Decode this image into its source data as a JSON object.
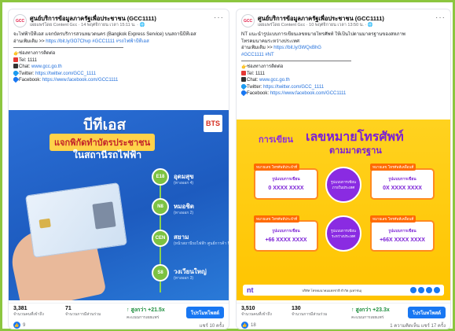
{
  "posts": [
    {
      "page_name": "ศูนย์บริการข้อมูลภาครัฐเพื่อประชาชน (GCC1111)",
      "meta": "เผยแพร่โดย Content Gcc · 14 พฤศจิกายน เวลา 15:11 น. · 🌐",
      "body_line1": "จะไฟฟ้าบีทีเอส แจกบัตรบริการสวนหมวดนคร (Bangkok Express Service) บนสถานีบีทีเอส",
      "body_line2_pre": "อ่านเพิ่มเติม >> ",
      "body_link": "https://bit.ly/3O7Chvp #GCC1111 #รถไฟฟ้าบีทีเอส",
      "contact_header": "ช่องทางการติดต่อ",
      "tel": "Tel: 1111",
      "chat_label": "Chat: ",
      "chat_link": "www.gcc.go.th",
      "twitter_label": "Twitter: ",
      "twitter_link": "https://twitter.com/GCC_1111",
      "facebook_label": "Facebook: ",
      "facebook_link": "https://www.facebook.com/GCC1111",
      "poster": {
        "title": "บีทีเอส",
        "sub": "แจกพิกัดทำบัตรประชาชน",
        "sub2": "ในสถานีรถไฟฟ้า",
        "brand": "BTS",
        "stops": [
          {
            "code": "E18",
            "name": "อุดมสุข",
            "sub": "(ทางออก 4)"
          },
          {
            "code": "N8",
            "name": "หมอชิต",
            "sub": "(ทางออก 2)"
          },
          {
            "code": "CEN",
            "name": "สยาม",
            "sub": "(หน้าสถานีรถไฟฟ้า ศูนย์การค้า MBK)"
          },
          {
            "code": "S8",
            "name": "วงเวียนใหญ่",
            "sub": "(ทางออก 3)"
          }
        ]
      },
      "stats": {
        "reach_value": "3,381",
        "reach_label": "จำนวนคนที่เข้าถึง",
        "engagement_value": "71",
        "engagement_label": "จำนวนการมีส่วนร่วม",
        "score_value": "↑ สูงกว่า +21.5x",
        "score_label": "คะแนนการเผยแพร่",
        "boost_label": "โปรโมทโพสต์"
      },
      "likes": "9",
      "views": "แชร์ 10 ครั้ง"
    },
    {
      "page_name": "ศูนย์บริการข้อมูลภาครัฐเพื่อประชาชน (GCC1111)",
      "meta": "เผยแพร่โดย Content Gcc · 10 พฤศจิกายน เวลา 13:50 น. · 🌐",
      "body_line1": "NT แนะนำรูปแบบการเขียนเลขหมายโทรศัพท์ ให้เป็นไปตามมาตรฐานของสหภาพ",
      "body_line1b": "โทรคมนาคมระหว่างประเทศ",
      "body_line2_pre": "อ่านเพิ่มเติม >> ",
      "body_link": "https://bit.ly/3WQxBhG",
      "body_tags": "#GCC1111 #NT",
      "contact_header": "ช่องทางการติดต่อ",
      "tel": "Tel: 1111",
      "chat_label": "Chat: ",
      "chat_link": "www.gcc.go.th",
      "twitter_label": "Twitter: ",
      "twitter_link": "https://twitter.com/GCC_1111",
      "facebook_label": "Facebook: ",
      "facebook_link": "https://www.facebook.com/GCC1111",
      "poster": {
        "title_pre": "การเขียน",
        "title_main": "เลขหมายโทรศัพท์",
        "title_sub": "ตามมาตรฐาน",
        "boxes": [
          {
            "tag": "หมายเลข โทรศัพท์ประจำที่",
            "label": "รูปแบบการเขียน",
            "number": "0 XXXX XXXX"
          },
          {
            "tag": "หมายเลข โทรศัพท์เคลื่อนที่",
            "label": "รูปแบบการเขียน",
            "number": "0X XXXX XXXX"
          },
          {
            "tag": "หมายเลข โทรศัพท์ประจำที่",
            "label": "รูปแบบการเขียน",
            "number": "+66 XXXX XXXX"
          },
          {
            "tag": "หมายเลข โทรศัพท์เคลื่อนที่",
            "label": "รูปแบบการเขียน",
            "number": "+66X XXXX XXXX"
          }
        ],
        "circle_top": "รูปแบบการเขียน ภายในประเทศ",
        "circle_bottom": "รูปแบบการเขียน ระหว่างประเทศ",
        "footer_brand": "nt",
        "footer_company": "บริษัท โทรคมนาคมแห่งชาติ จำกัด (มหาชน)"
      },
      "stats": {
        "reach_value": "3,510",
        "reach_label": "จำนวนคนที่เข้าถึง",
        "engagement_value": "130",
        "engagement_label": "จำนวนการมีส่วนร่วม",
        "score_value": "↑ สูงกว่า +23.3x",
        "score_label": "คะแนนการเผยแพร่",
        "boost_label": "โปรโมทโพสต์"
      },
      "likes": "18",
      "views": "1 ความคิดเห็น แชร์ 17 ครั้ง"
    }
  ],
  "colors": {
    "frame_border": "#8cc63f",
    "link": "#216fdb",
    "boost": "#1877f2",
    "up": "#1e8e3e"
  }
}
